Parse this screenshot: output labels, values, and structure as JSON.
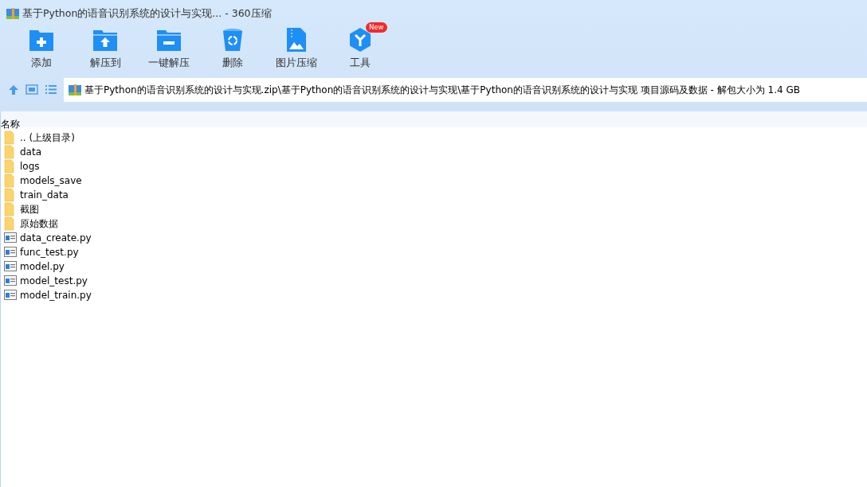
{
  "window": {
    "title": "基于Python的语音识别系统的设计与实现... - 360压缩"
  },
  "toolbar": [
    {
      "kind": "add",
      "label": "添加"
    },
    {
      "kind": "extract",
      "label": "解压到"
    },
    {
      "kind": "quick",
      "label": "一键解压"
    },
    {
      "kind": "delete",
      "label": "删除"
    },
    {
      "kind": "image",
      "label": "图片压缩"
    },
    {
      "kind": "tools",
      "label": "工具",
      "badge": "New"
    }
  ],
  "address_bar": {
    "path": "基于Python的语音识别系统的设计与实现.zip\\基于Python的语音识别系统的设计与实现\\基于Python的语音识别系统的设计与实现 项目源码及数据 - 解包大小为 1.4 GB"
  },
  "file_list": {
    "columns": [
      "名称"
    ],
    "rows": [
      {
        "kind": "folder",
        "name": ".. (上级目录)"
      },
      {
        "kind": "folder",
        "name": "data"
      },
      {
        "kind": "folder",
        "name": "logs"
      },
      {
        "kind": "folder",
        "name": "models_save"
      },
      {
        "kind": "folder",
        "name": "train_data"
      },
      {
        "kind": "folder",
        "name": "截图"
      },
      {
        "kind": "folder",
        "name": "原始数据"
      },
      {
        "kind": "file",
        "name": "data_create.py"
      },
      {
        "kind": "file",
        "name": "func_test.py"
      },
      {
        "kind": "file",
        "name": "model.py"
      },
      {
        "kind": "file",
        "name": "model_test.py"
      },
      {
        "kind": "file",
        "name": "model_train.py"
      }
    ]
  }
}
